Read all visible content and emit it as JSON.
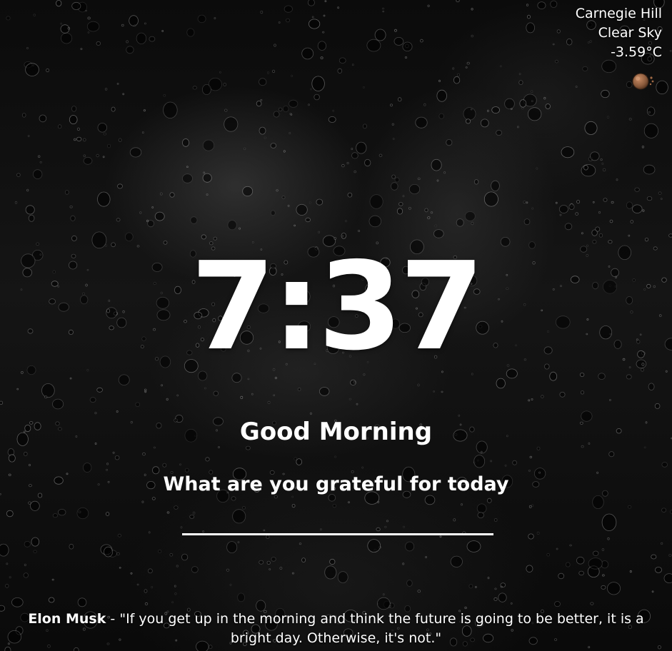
{
  "weather": {
    "location": "Carnegie Hill",
    "condition": "Clear Sky",
    "temperature": "-3.59°C",
    "icon": "clear-sky-sun-icon"
  },
  "clock": {
    "time": "7:37"
  },
  "greeting": {
    "text": "Good Morning"
  },
  "focus": {
    "question": "What are you grateful for today",
    "input_value": ""
  },
  "quote": {
    "author": "Elon Musk",
    "separator": " - ",
    "text": "\"If you get up in the morning and think the future is going to be better, it is a bright day. Otherwise, it's not.\""
  },
  "colors": {
    "text": "#ffffff",
    "background": "#0b0b0b",
    "icon_sun": "#8a5a3c"
  }
}
